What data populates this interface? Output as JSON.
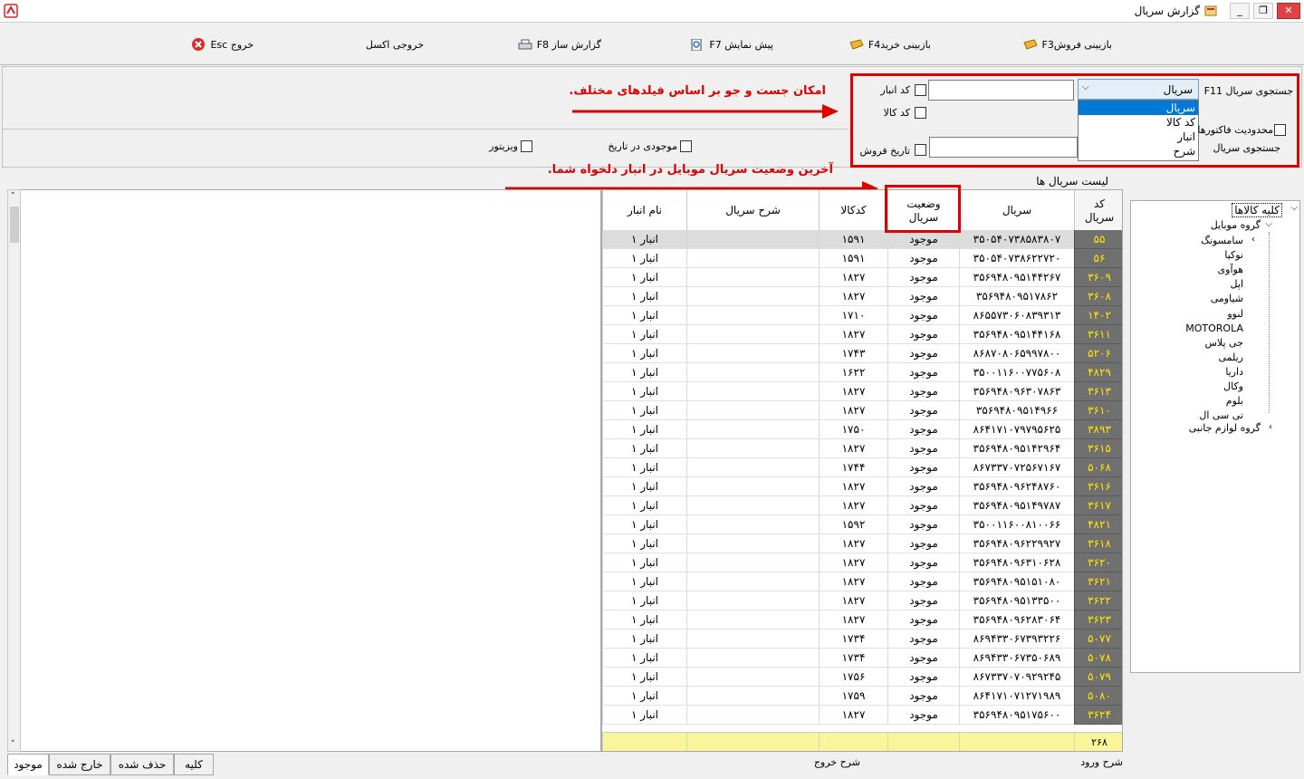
{
  "window": {
    "title": "گزارش سریال",
    "controls": [
      "_",
      "❐",
      "✕"
    ]
  },
  "toolbar": {
    "sales_review": "بازبینی فروشF3",
    "purchase_review": "بازبینی خریدF4",
    "preview": "پیش نمایش  F7",
    "report_builder": "گزارش ساز F8",
    "excel_export": "خروجی اکسل",
    "exit": "خروج  Esc"
  },
  "search": {
    "serial_search_label": "جستجوی سریال F11",
    "selected_field": "سریال",
    "field_options": [
      "سریال",
      "کد کالا",
      "انبار",
      "شرح"
    ],
    "warehouse_code_label": "کد انبار",
    "product_code_label": "کد کالا",
    "sale_date_label": "تاریخ فروش",
    "invoice_limit_label": "محدودیت فاکتورها",
    "serial_search_label2": "جستجوی سریال",
    "stock_on_date_label": "موجودی در تاریخ",
    "wizard_label": "ویزیتور"
  },
  "annotations": {
    "search_note": "امکان جست و جو بر اساس فیلدهای مختلف.",
    "status_note": "آخرین وضعیت سریال موبایل در انبار دلخواه شما."
  },
  "list_title": "لیست سریال ها",
  "table": {
    "headers": [
      "کد سریال",
      "سریال",
      "وضعیت سریال",
      "کدکالا",
      "شرح سریال",
      "نام انبار"
    ],
    "rows": [
      [
        "۵۵",
        "۳۵۰۵۴۰۷۳۸۵۸۳۸۰۷",
        "موجود",
        "۱۵۹۱",
        "",
        "انبار ۱"
      ],
      [
        "۵۶",
        "۳۵۰۵۴۰۷۳۸۶۲۲۷۲۰",
        "موجود",
        "۱۵۹۱",
        "",
        "انبار ۱"
      ],
      [
        "۳۶۰۹",
        "۳۵۶۹۴۸۰۹۵۱۴۴۲۶۷",
        "موجود",
        "۱۸۲۷",
        "",
        "انبار ۱"
      ],
      [
        "۳۶۰۸",
        "۳۵۶۹۴۸۰۹۵۱۷۸۶۲",
        "موجود",
        "۱۸۲۷",
        "",
        "انبار ۱"
      ],
      [
        "۱۴۰۲",
        "۸۶۵۵۷۳۰۶۰۸۳۹۳۱۳",
        "موجود",
        "۱۷۱۰",
        "",
        "انبار ۱"
      ],
      [
        "۳۶۱۱",
        "۳۵۶۹۴۸۰۹۵۱۴۴۱۶۸",
        "موجود",
        "۱۸۲۷",
        "",
        "انبار ۱"
      ],
      [
        "۵۲۰۶",
        "۸۶۸۷۰۸۰۶۵۹۹۷۸۰۰",
        "موجود",
        "۱۷۴۳",
        "",
        "انبار ۱"
      ],
      [
        "۴۸۲۹",
        "۳۵۰۰۱۱۶۰۰۷۷۵۶۰۸",
        "موجود",
        "۱۶۲۲",
        "",
        "انبار ۱"
      ],
      [
        "۳۶۱۳",
        "۳۵۶۹۴۸۰۹۶۳۰۷۸۶۳",
        "موجود",
        "۱۸۲۷",
        "",
        "انبار ۱"
      ],
      [
        "۳۶۱۰",
        "۳۵۶۹۴۸۰۹۵۱۴۹۶۶",
        "موجود",
        "۱۸۲۷",
        "",
        "انبار ۱"
      ],
      [
        "۳۸۹۳",
        "۸۶۴۱۷۱۰۷۹۷۹۵۶۲۵",
        "موجود",
        "۱۷۵۰",
        "",
        "انبار ۱"
      ],
      [
        "۳۶۱۵",
        "۳۵۶۹۴۸۰۹۵۱۴۲۹۶۴",
        "موجود",
        "۱۸۲۷",
        "",
        "انبار ۱"
      ],
      [
        "۵۰۶۸",
        "۸۶۷۳۳۷۰۷۲۵۶۷۱۶۷",
        "موجود",
        "۱۷۴۴",
        "",
        "انبار ۱"
      ],
      [
        "۳۶۱۶",
        "۳۵۶۹۴۸۰۹۶۲۴۸۷۶۰",
        "موجود",
        "۱۸۲۷",
        "",
        "انبار ۱"
      ],
      [
        "۳۶۱۷",
        "۳۵۶۹۴۸۰۹۵۱۴۹۷۸۷",
        "موجود",
        "۱۸۲۷",
        "",
        "انبار ۱"
      ],
      [
        "۴۸۲۱",
        "۳۵۰۰۱۱۶۰۰۸۱۰۰۶۶",
        "موجود",
        "۱۵۹۲",
        "",
        "انبار ۱"
      ],
      [
        "۳۶۱۸",
        "۳۵۶۹۴۸۰۹۶۲۲۹۹۲۷",
        "موجود",
        "۱۸۲۷",
        "",
        "انبار ۱"
      ],
      [
        "۳۶۲۰",
        "۳۵۶۹۴۸۰۹۶۳۱۰۶۲۸",
        "موجود",
        "۱۸۲۷",
        "",
        "انبار ۱"
      ],
      [
        "۳۶۲۱",
        "۳۵۶۹۴۸۰۹۵۱۵۱۰۸۰",
        "موجود",
        "۱۸۲۷",
        "",
        "انبار ۱"
      ],
      [
        "۳۶۲۲",
        "۳۵۶۹۴۸۰۹۵۱۳۳۵۰۰",
        "موجود",
        "۱۸۲۷",
        "",
        "انبار ۱"
      ],
      [
        "۳۶۲۳",
        "۳۵۶۹۴۸۰۹۶۲۸۳۰۶۴",
        "موجود",
        "۱۸۲۷",
        "",
        "انبار ۱"
      ],
      [
        "۵۰۷۷",
        "۸۶۹۴۳۳۰۶۷۳۹۳۲۲۶",
        "موجود",
        "۱۷۳۴",
        "",
        "انبار ۱"
      ],
      [
        "۵۰۷۸",
        "۸۶۹۴۳۳۰۶۷۳۵۰۶۸۹",
        "موجود",
        "۱۷۳۴",
        "",
        "انبار ۱"
      ],
      [
        "۵۰۷۹",
        "۸۶۷۳۳۷۰۷۰۹۲۹۲۴۵",
        "موجود",
        "۱۷۵۶",
        "",
        "انبار ۱"
      ],
      [
        "۵۰۸۰",
        "۸۶۴۱۷۱۰۷۱۲۷۱۹۸۹",
        "موجود",
        "۱۷۵۹",
        "",
        "انبار ۱"
      ],
      [
        "۳۶۲۴",
        "۳۵۶۹۴۸۰۹۵۱۷۵۶۰۰",
        "موجود",
        "۱۸۲۷",
        "",
        "انبار ۱"
      ]
    ],
    "footer_total": "۲۶۸"
  },
  "tree": {
    "root": "کلیه کالاها",
    "groups": [
      {
        "label": "گروه موبایل",
        "children": [
          "سامسونگ",
          "نوکیا",
          "هوآوی",
          "اپل",
          "شیاومی",
          "لنوو",
          "MOTOROLA",
          "جی پلاس",
          "ریلمی",
          "داریا",
          "وکال",
          "بلوم",
          "تی سی ال"
        ]
      },
      {
        "label": "گروه لوازم جانبی",
        "children": []
      }
    ]
  },
  "bottom": {
    "entry_desc": "شرح ورود",
    "exit_desc": "شرح خروج"
  },
  "tabs": [
    "موجود",
    "خارج شده",
    "حذف شده",
    "کلیه"
  ],
  "colors": {
    "annotation_red": "#e00000",
    "code_cell_bg": "#707070",
    "code_cell_text": "#ffe600",
    "footer_bg": "#f9f59a",
    "select_highlight": "#0078d7"
  }
}
